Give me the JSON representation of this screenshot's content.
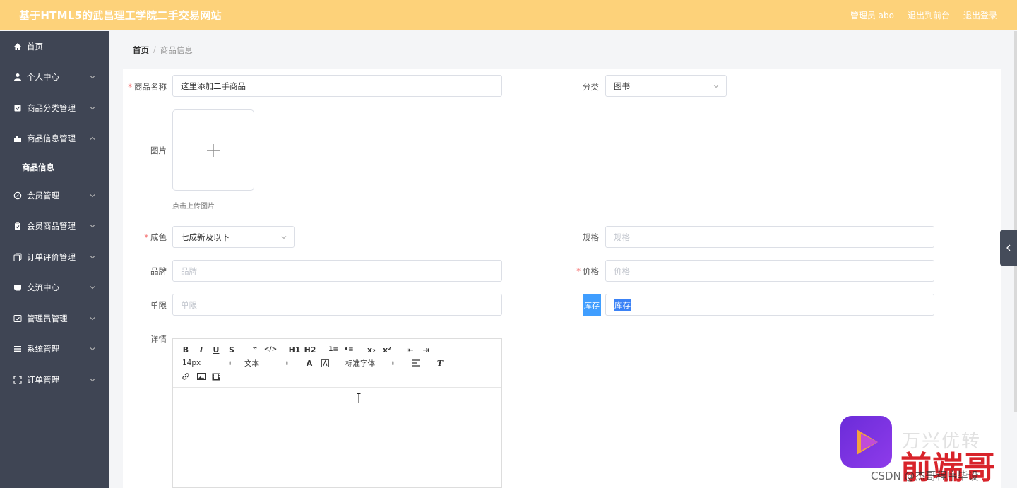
{
  "header": {
    "title": "基于HTML5的武昌理工学院二手交易网站",
    "admin": "管理员 abo",
    "back_front": "退出到前台",
    "logout": "退出登录"
  },
  "sidebar": {
    "items": [
      {
        "label": "首页",
        "icon": "home-icon"
      },
      {
        "label": "个人中心",
        "icon": "user-icon"
      },
      {
        "label": "商品分类管理",
        "icon": "category-icon"
      },
      {
        "label": "商品信息管理",
        "icon": "goods-icon"
      },
      {
        "label": "会员管理",
        "icon": "compass-icon"
      },
      {
        "label": "会员商品管理",
        "icon": "clipboard-icon"
      },
      {
        "label": "订单评价管理",
        "icon": "copy-icon"
      },
      {
        "label": "交流中心",
        "icon": "chat-icon"
      },
      {
        "label": "管理员管理",
        "icon": "checkbox-icon"
      },
      {
        "label": "系统管理",
        "icon": "menu-icon"
      },
      {
        "label": "订单管理",
        "icon": "fullscreen-icon"
      }
    ],
    "sub_item": "商品信息"
  },
  "breadcrumb": {
    "home": "首页",
    "sep": "/",
    "current": "商品信息"
  },
  "form": {
    "name_label": "商品名称",
    "name_value": "这里添加二手商品",
    "category_label": "分类",
    "category_value": "图书",
    "image_label": "图片",
    "upload_hint": "点击上传图片",
    "condition_label": "成色",
    "condition_value": "七成新及以下",
    "spec_label": "规格",
    "spec_placeholder": "规格",
    "brand_label": "品牌",
    "brand_placeholder": "品牌",
    "price_label": "价格",
    "price_placeholder": "价格",
    "limit_label": "单限",
    "limit_placeholder": "单限",
    "stock_label": "库存",
    "stock_value": "库存",
    "detail_label": "详情"
  },
  "editor": {
    "font_size": "14px",
    "text_type": "文本",
    "font_family": "标准字体",
    "buttons_row1": [
      "B",
      "I",
      "U",
      "S",
      "❞",
      "</>",
      "H1",
      "H2",
      "1≡",
      "•≡",
      "x₂",
      "x²",
      "⇤",
      "⇥"
    ]
  },
  "watermark": {
    "brand": "万兴优转",
    "red": "前端哥",
    "csdn": "CSDN @杰哥程序毕设"
  },
  "colors": {
    "header": "#fdd27a",
    "sidebar": "#3f4554",
    "accent": "#409eff",
    "required": "#f56c6c"
  }
}
